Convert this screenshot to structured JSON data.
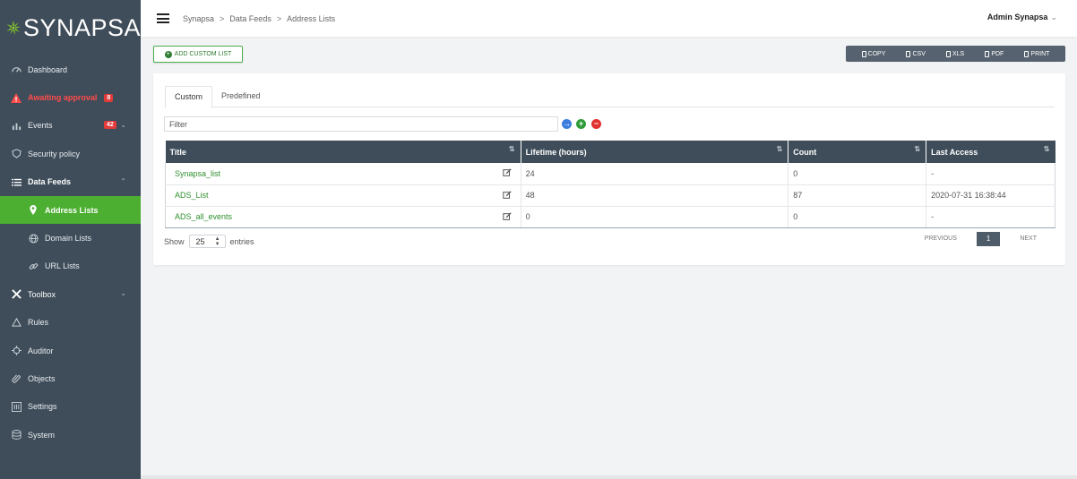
{
  "app": {
    "brand": "SYNAPSA"
  },
  "sidebar": {
    "items": [
      {
        "label": "Dashboard",
        "icon": "dashboard-icon"
      },
      {
        "label": "Awaiting approval",
        "icon": "warning-icon",
        "badge": "8"
      },
      {
        "label": "Events",
        "icon": "bar-chart-icon",
        "badge": "42"
      },
      {
        "label": "Security policy",
        "icon": "shield-icon"
      },
      {
        "label": "Data Feeds",
        "icon": "list-icon"
      },
      {
        "label": "Address Lists",
        "icon": "map-pin-icon"
      },
      {
        "label": "Domain Lists",
        "icon": "globe-icon"
      },
      {
        "label": "URL Lists",
        "icon": "link-icon"
      },
      {
        "label": "Toolbox",
        "icon": "tools-icon"
      },
      {
        "label": "Rules",
        "icon": "triangle-icon"
      },
      {
        "label": "Auditor",
        "icon": "crosshair-icon"
      },
      {
        "label": "Objects",
        "icon": "paperclip-icon"
      },
      {
        "label": "Settings",
        "icon": "sliders-icon"
      },
      {
        "label": "System",
        "icon": "database-icon"
      }
    ]
  },
  "header": {
    "breadcrumb": [
      "Synapsa",
      "Data Feeds",
      "Address Lists"
    ],
    "separator": ">",
    "user": "Admin Synapsa"
  },
  "toolbar": {
    "add_label": "ADD CUSTOM LIST",
    "exports": [
      "COPY",
      "CSV",
      "XLS",
      "PDF",
      "PRINT"
    ]
  },
  "tabs": [
    "Custom",
    "Predefined"
  ],
  "filter": {
    "placeholder": "Filter"
  },
  "table": {
    "columns": [
      "Title",
      "Lifetime (hours)",
      "Count",
      "Last Access"
    ],
    "rows": [
      {
        "title": "Synapsa_list",
        "lifetime": "24",
        "count": "0",
        "last_access": "-"
      },
      {
        "title": "ADS_List",
        "lifetime": "48",
        "count": "87",
        "last_access": "2020-07-31 16:38:44"
      },
      {
        "title": "ADS_all_events",
        "lifetime": "0",
        "count": "0",
        "last_access": "-"
      }
    ]
  },
  "length": {
    "show": "Show",
    "value": "25",
    "entries": "entries"
  },
  "pagination": {
    "previous": "PREVIOUS",
    "current": "1",
    "next": "NEXT"
  },
  "colors": {
    "sidebar": "#3f4d5a",
    "active": "#4caf31",
    "alert": "#ff4a4a",
    "link": "#2f8f2f"
  }
}
